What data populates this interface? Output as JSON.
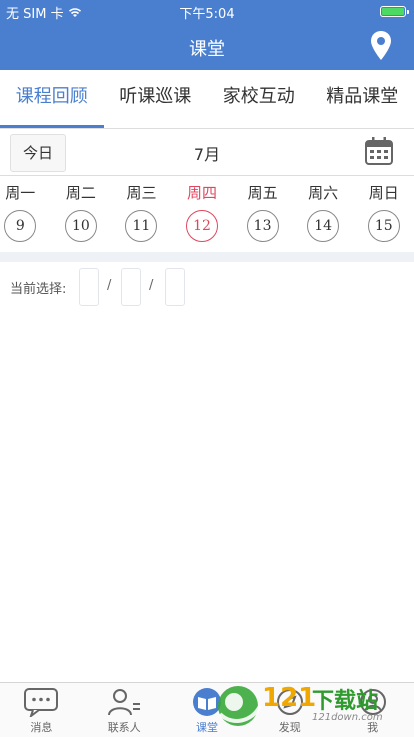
{
  "status_bar": {
    "carrier": "无 SIM 卡",
    "time": "下午5:04",
    "battery_color": "#4cd964"
  },
  "nav": {
    "title": "课堂",
    "location_icon": "location-pin-icon"
  },
  "tabs": [
    {
      "label": "课程回顾",
      "active": true
    },
    {
      "label": "听课巡课",
      "active": false
    },
    {
      "label": "家校互动",
      "active": false
    },
    {
      "label": "精品课堂",
      "active": false
    }
  ],
  "date_row": {
    "today_label": "今日",
    "month": "7月",
    "calendar_icon": "calendar-icon"
  },
  "week": [
    {
      "name": "周一",
      "num": "9"
    },
    {
      "name": "周二",
      "num": "10"
    },
    {
      "name": "周三",
      "num": "11"
    },
    {
      "name": "周四",
      "num": "12",
      "selected": true
    },
    {
      "name": "周五",
      "num": "13"
    },
    {
      "name": "周六",
      "num": "14"
    },
    {
      "name": "周日",
      "num": "15"
    }
  ],
  "selection": {
    "label": "当前选择:",
    "separator": "/"
  },
  "tabbar": [
    {
      "label": "消息",
      "icon": "message-icon"
    },
    {
      "label": "联系人",
      "icon": "contacts-icon"
    },
    {
      "label": "课堂",
      "icon": "book-icon",
      "active": true
    },
    {
      "label": "发现",
      "icon": "discover-icon"
    },
    {
      "label": "我",
      "icon": "profile-icon"
    }
  ],
  "watermark": {
    "brand": "121",
    "text": "下载站",
    "sub": "121down.com"
  },
  "colors": {
    "accent": "#4a7fd0",
    "selected_day": "#e0475e"
  }
}
